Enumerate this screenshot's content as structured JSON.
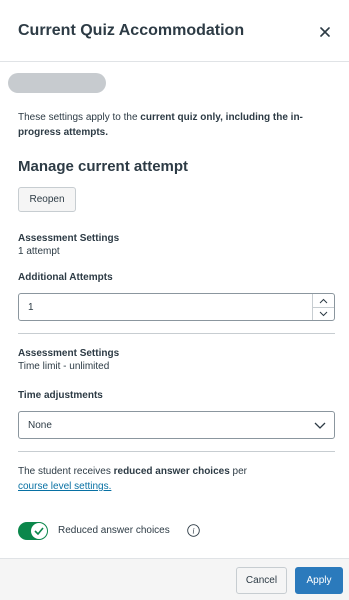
{
  "header": {
    "title": "Current Quiz Accommodation",
    "close_icon": "close-icon"
  },
  "student": {
    "name": ""
  },
  "info": {
    "prefix": "These settings apply to the ",
    "bold": "current quiz only, including the in-progress attempts."
  },
  "manage": {
    "title": "Manage current attempt",
    "reopen_label": "Reopen"
  },
  "attempts": {
    "heading": "Assessment Settings",
    "summary": "1 attempt",
    "field_label": "Additional Attempts",
    "value": "1"
  },
  "time": {
    "heading": "Assessment Settings",
    "summary": "Time limit - unlimited",
    "field_label": "Time adjustments",
    "selected": "None"
  },
  "reduced": {
    "prefix": "The student receives ",
    "bold": "reduced answer choices",
    "suffix": " per",
    "link": "course level settings."
  },
  "toggle": {
    "label": "Reduced answer choices",
    "on": true,
    "color": "#0b874b"
  },
  "footer": {
    "cancel": "Cancel",
    "apply": "Apply",
    "apply_color": "#2b7abc"
  }
}
